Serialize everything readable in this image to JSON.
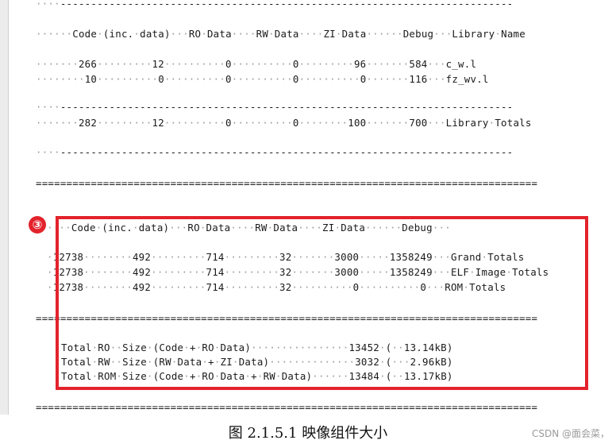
{
  "lines": [
    "····--------------------------------------------------------------------------",
    "······Code·(inc.·data)···RO·Data····RW·Data····ZI·Data······Debug···Library·Name",
    "·······266·········12··········0··········0·········96·······584···c_w.l",
    "········10··········0··········0··········0··········0·······116···fz_wv.l",
    "····--------------------------------------------------------------------------",
    "·······282·········12··········0··········0········100·······700···Library·Totals",
    "····--------------------------------------------------------------------------",
    "==================================================================================",
    "····Code·(inc.·data)···RO·Data····RW·Data····ZI·Data······Debug···",
    "·12738········492·········714·········32·······3000·····1358249···Grand·Totals",
    "·12738········492·········714·········32·······3000·····1358249···ELF·Image·Totals",
    "·12738········492·········714·········32··········0··········0···ROM·Totals",
    "==================================================================================",
    "Total·RO··Size·(Code·+·RO·Data)················13452·(··13.14kB)",
    "Total·RW··Size·(RW·Data·+·ZI·Data)··············3032·(···2.96kB)",
    "Total·ROM·Size·(Code·+·RO·Data·+·RW·Data)······13484·(··13.17kB)",
    "=================================================================================="
  ],
  "annotation": {
    "badge": "③"
  },
  "caption": "图 2.1.5.1  映像组件大小",
  "watermark": "CSDN @面会菜，"
}
